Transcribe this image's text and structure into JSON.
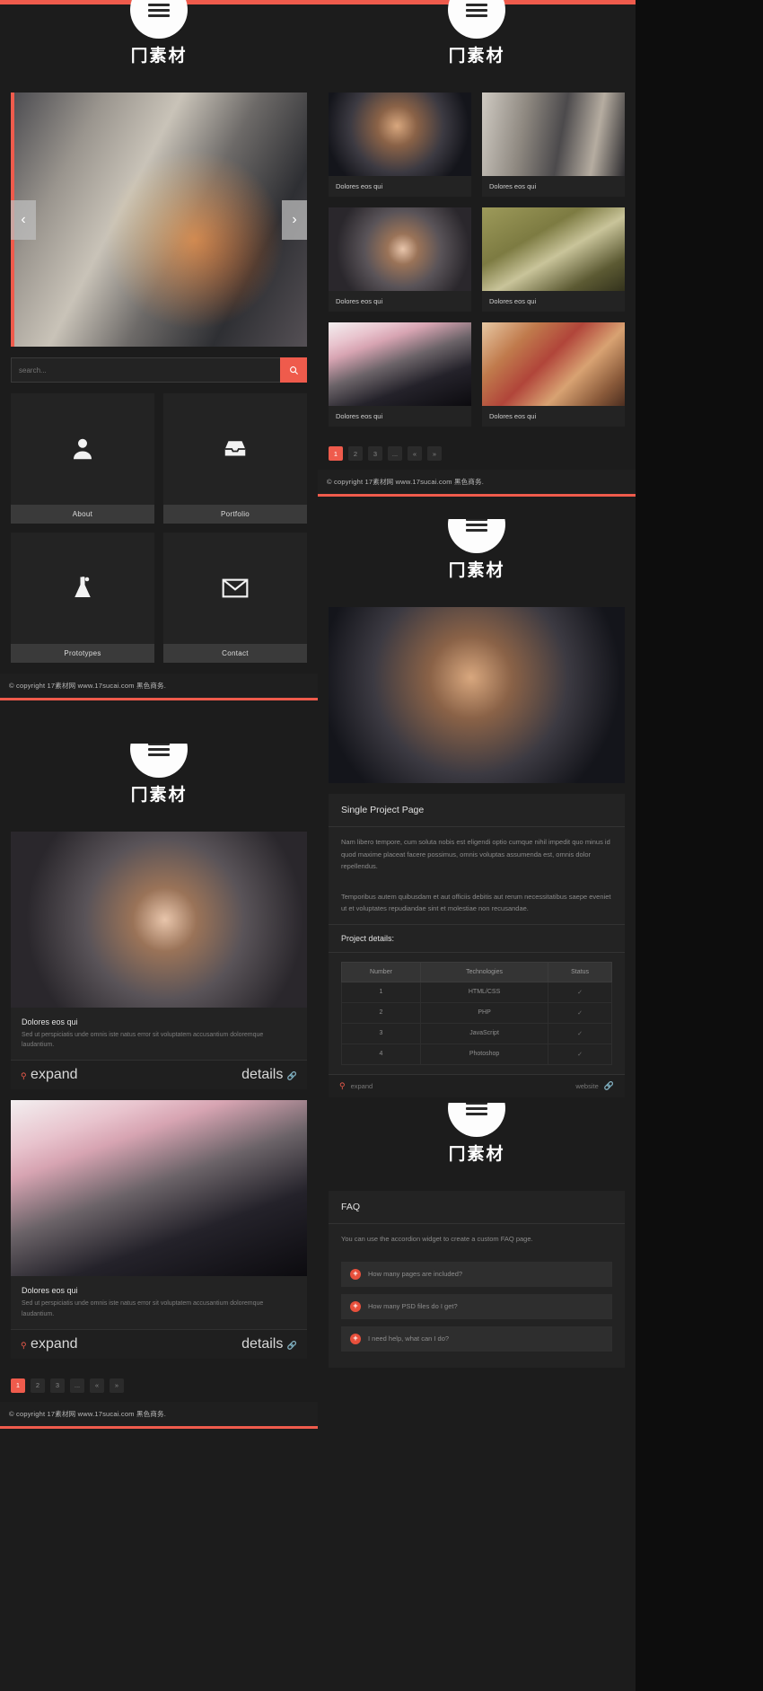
{
  "brand": {
    "logo": "冂素材"
  },
  "colors": {
    "accent": "#ef5b4c",
    "panel": "#1c1c1c",
    "tile": "#232323"
  },
  "footer": {
    "copyright": "© copyright 17素材网 www.17sucai.com 黑色商务."
  },
  "home": {
    "search": {
      "placeholder": "search...",
      "value": "",
      "button_icon": "search-icon"
    },
    "slider": {
      "prev": "‹",
      "next": "›"
    },
    "tiles": [
      {
        "label": "About",
        "icon": "user-icon"
      },
      {
        "label": "Portfolio",
        "icon": "inbox-icon"
      },
      {
        "label": "Prototypes",
        "icon": "flask-icon"
      },
      {
        "label": "Contact",
        "icon": "envelope-icon"
      }
    ]
  },
  "gallery": {
    "items": [
      {
        "caption": "Dolores eos qui"
      },
      {
        "caption": "Dolores eos qui"
      },
      {
        "caption": "Dolores eos qui"
      },
      {
        "caption": "Dolores eos qui"
      },
      {
        "caption": "Dolores eos qui"
      },
      {
        "caption": "Dolores eos qui"
      }
    ],
    "pagination": [
      "1",
      "2",
      "3",
      "...",
      "«",
      "»"
    ],
    "active_page": "1"
  },
  "project": {
    "title": "Single Project Page",
    "paragraph1": "Nam libero tempore, cum soluta nobis est eligendi optio cumque nihil impedit quo minus id quod maxime placeat facere possimus, omnis voluptas assumenda est, omnis dolor repellendus.",
    "paragraph2": "Temporibus autem quibusdam et aut officiis debitis aut rerum necessitatibus saepe eveniet ut et voluptates repudiandae sint et molestiae non recusandae.",
    "details_heading": "Project details:",
    "table": {
      "headers": [
        "Number",
        "Technologies",
        "Status"
      ],
      "rows": [
        [
          "1",
          "HTML/CSS",
          "✓"
        ],
        [
          "2",
          "PHP",
          "✓"
        ],
        [
          "3",
          "JavaScript",
          "✓"
        ],
        [
          "4",
          "Photoshop",
          "✓"
        ]
      ]
    },
    "footer": {
      "expand": "expand",
      "website": "website"
    }
  },
  "blog": {
    "posts": [
      {
        "title": "Dolores eos qui",
        "excerpt": "Sed ut perspiciatis unde omnis iste natus error sit voluptatem accusantium doloremque laudantium.",
        "expand": "expand",
        "details": "details"
      },
      {
        "title": "Dolores eos qui",
        "excerpt": "Sed ut perspiciatis unde omnis iste natus error sit voluptatem accusantium doloremque laudantium.",
        "expand": "expand",
        "details": "details"
      }
    ],
    "pagination": [
      "1",
      "2",
      "3",
      "...",
      "«",
      "»"
    ],
    "active_page": "1"
  },
  "faq": {
    "title": "FAQ",
    "intro": "You can use the accordion widget to create a custom FAQ page.",
    "items": [
      {
        "question": "How many pages are included?"
      },
      {
        "question": "How many PSD files do I get?"
      },
      {
        "question": "I need help, what can I do?"
      }
    ]
  }
}
